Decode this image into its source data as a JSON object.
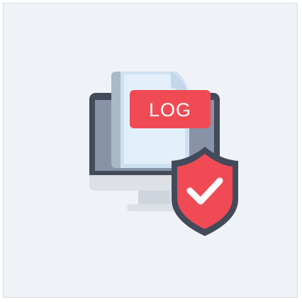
{
  "illustration": {
    "badge_text": "LOG",
    "icons": {
      "monitor": "monitor-icon",
      "document": "log-document-icon",
      "shield": "shield-check-icon"
    },
    "colors": {
      "background": "#eff3f7",
      "monitor_frame": "#434a59",
      "monitor_screen": "#8893a8",
      "monitor_base": "#dde1e6",
      "document_back": "#a9b9c7",
      "document_front": "#dbeaf8",
      "badge": "#f04b54",
      "shield": "#f04b54",
      "shield_outline": "#434a59",
      "check": "#ffffff"
    }
  }
}
